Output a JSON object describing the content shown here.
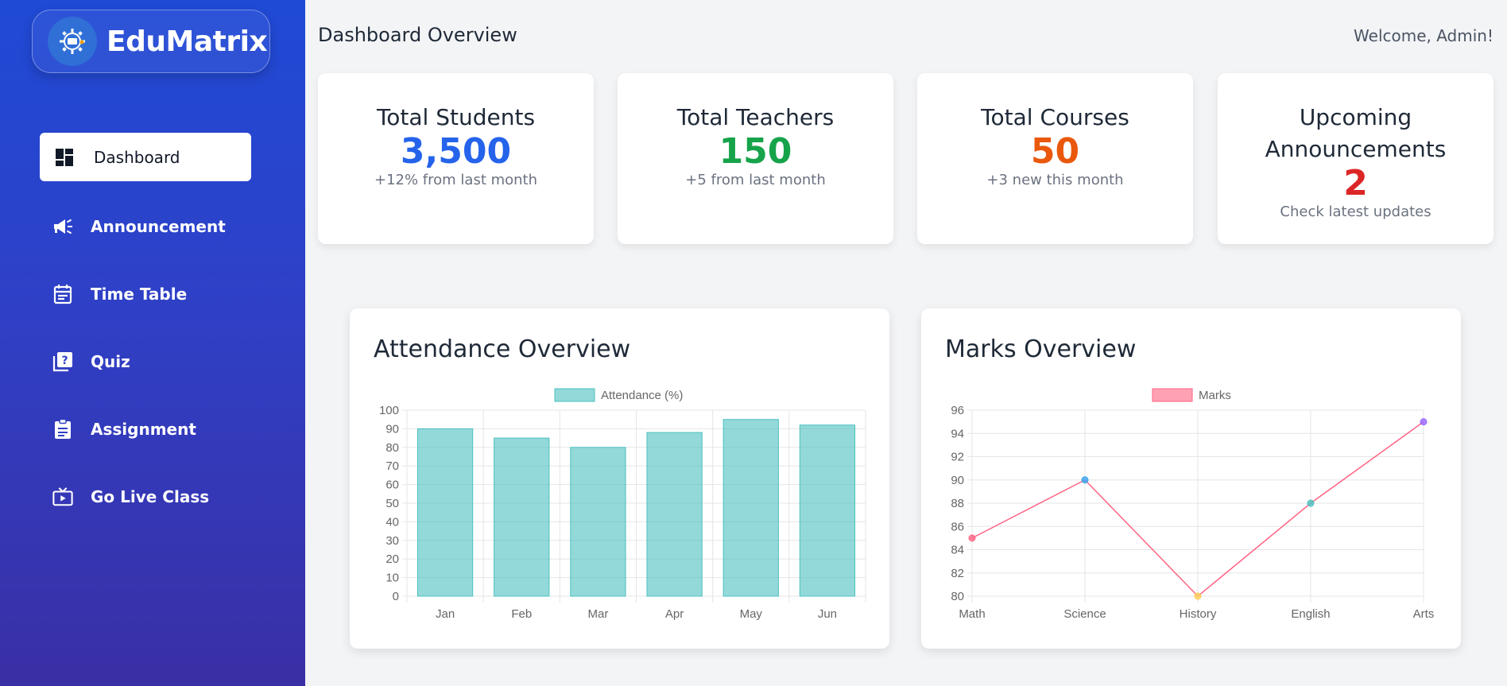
{
  "app": {
    "name": "EduMatrix"
  },
  "sidebar": {
    "items": [
      {
        "label": "Dashboard",
        "icon": "dashboard-icon",
        "active": true
      },
      {
        "label": "Announcement",
        "icon": "megaphone-icon",
        "active": false
      },
      {
        "label": "Time Table",
        "icon": "calendar-icon",
        "active": false
      },
      {
        "label": "Quiz",
        "icon": "quiz-icon",
        "active": false
      },
      {
        "label": "Assignment",
        "icon": "clipboard-icon",
        "active": false
      },
      {
        "label": "Go Live Class",
        "icon": "live-tv-icon",
        "active": false
      }
    ]
  },
  "header": {
    "title": "Dashboard Overview",
    "welcome": "Welcome, Admin!"
  },
  "stats": [
    {
      "title": "Total Students",
      "value": "3,500",
      "sub": "+12% from last month",
      "color": "#2563eb"
    },
    {
      "title": "Total Teachers",
      "value": "150",
      "sub": "+5 from last month",
      "color": "#16a34a"
    },
    {
      "title": "Total Courses",
      "value": "50",
      "sub": "+3 new this month",
      "color": "#ea580c"
    },
    {
      "title": "Upcoming Announcements",
      "value": "2",
      "sub": "Check latest updates",
      "color": "#dc2626"
    }
  ],
  "chart_data": [
    {
      "type": "bar",
      "title": "Attendance Overview",
      "categories": [
        "Jan",
        "Feb",
        "Mar",
        "Apr",
        "May",
        "Jun"
      ],
      "series": [
        {
          "name": "Attendance (%)",
          "values": [
            90,
            85,
            80,
            88,
            95,
            92
          ]
        }
      ],
      "ylim": [
        0,
        100
      ],
      "yticks": [
        0,
        10,
        20,
        30,
        40,
        50,
        60,
        70,
        80,
        90,
        100
      ],
      "grid": true,
      "legend": "top-center",
      "color": "#4bc0c0"
    },
    {
      "type": "line",
      "title": "Marks Overview",
      "categories": [
        "Math",
        "Science",
        "History",
        "English",
        "Arts"
      ],
      "series": [
        {
          "name": "Marks",
          "values": [
            85,
            90,
            80,
            88,
            95
          ]
        }
      ],
      "ylim": [
        80,
        96
      ],
      "yticks": [
        80,
        82,
        84,
        86,
        88,
        90,
        92,
        94,
        96
      ],
      "grid": true,
      "legend": "top-center",
      "color": "#ff6384",
      "point_colors": [
        "#ff6384",
        "#36a2eb",
        "#ffce56",
        "#4bc0c0",
        "#9966ff"
      ]
    }
  ]
}
